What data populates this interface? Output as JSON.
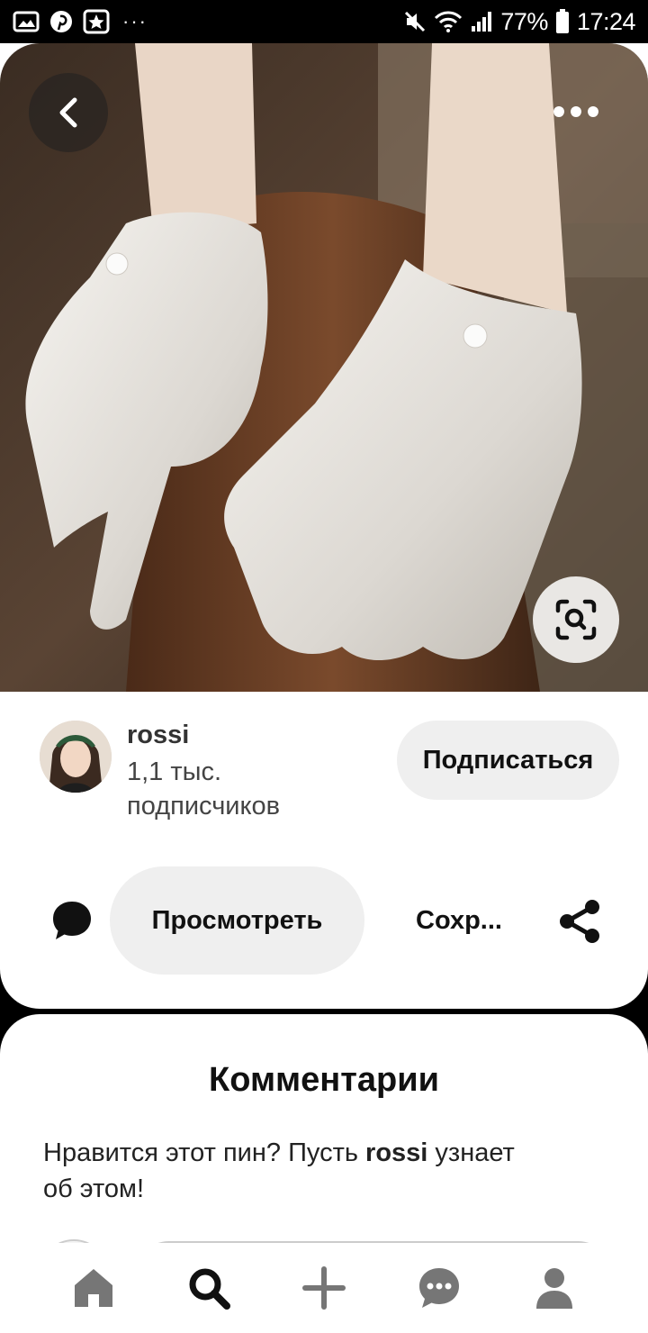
{
  "status_bar": {
    "battery_percent": "77%",
    "time": "17:24",
    "more": "···"
  },
  "pin": {
    "image_subject": "white satin gloves with pearl buttons"
  },
  "author": {
    "name": "rossi",
    "followers_count": "1,1 тыс.",
    "followers_label": "подписчиков",
    "follow_label": "Подписаться"
  },
  "actions": {
    "view_label": "Просмотреть",
    "save_label": "Сохр..."
  },
  "comments": {
    "title": "Комментарии",
    "prompt_prefix": "Нравится этот пин? Пусть ",
    "prompt_user": "rossi",
    "prompt_suffix": " узнает об этом!"
  },
  "colors": {
    "button_bg": "#efefef",
    "text": "#111111",
    "nav_icon": "#767676",
    "nav_active": "#111111"
  },
  "icons": {
    "back": "chevron-left-icon",
    "more": "more-horizontal-icon",
    "lens": "visual-search-icon",
    "comment": "speech-bubble-icon",
    "share": "share-icon",
    "nav": [
      "home-icon",
      "search-icon",
      "plus-icon",
      "messages-icon",
      "profile-icon"
    ]
  }
}
